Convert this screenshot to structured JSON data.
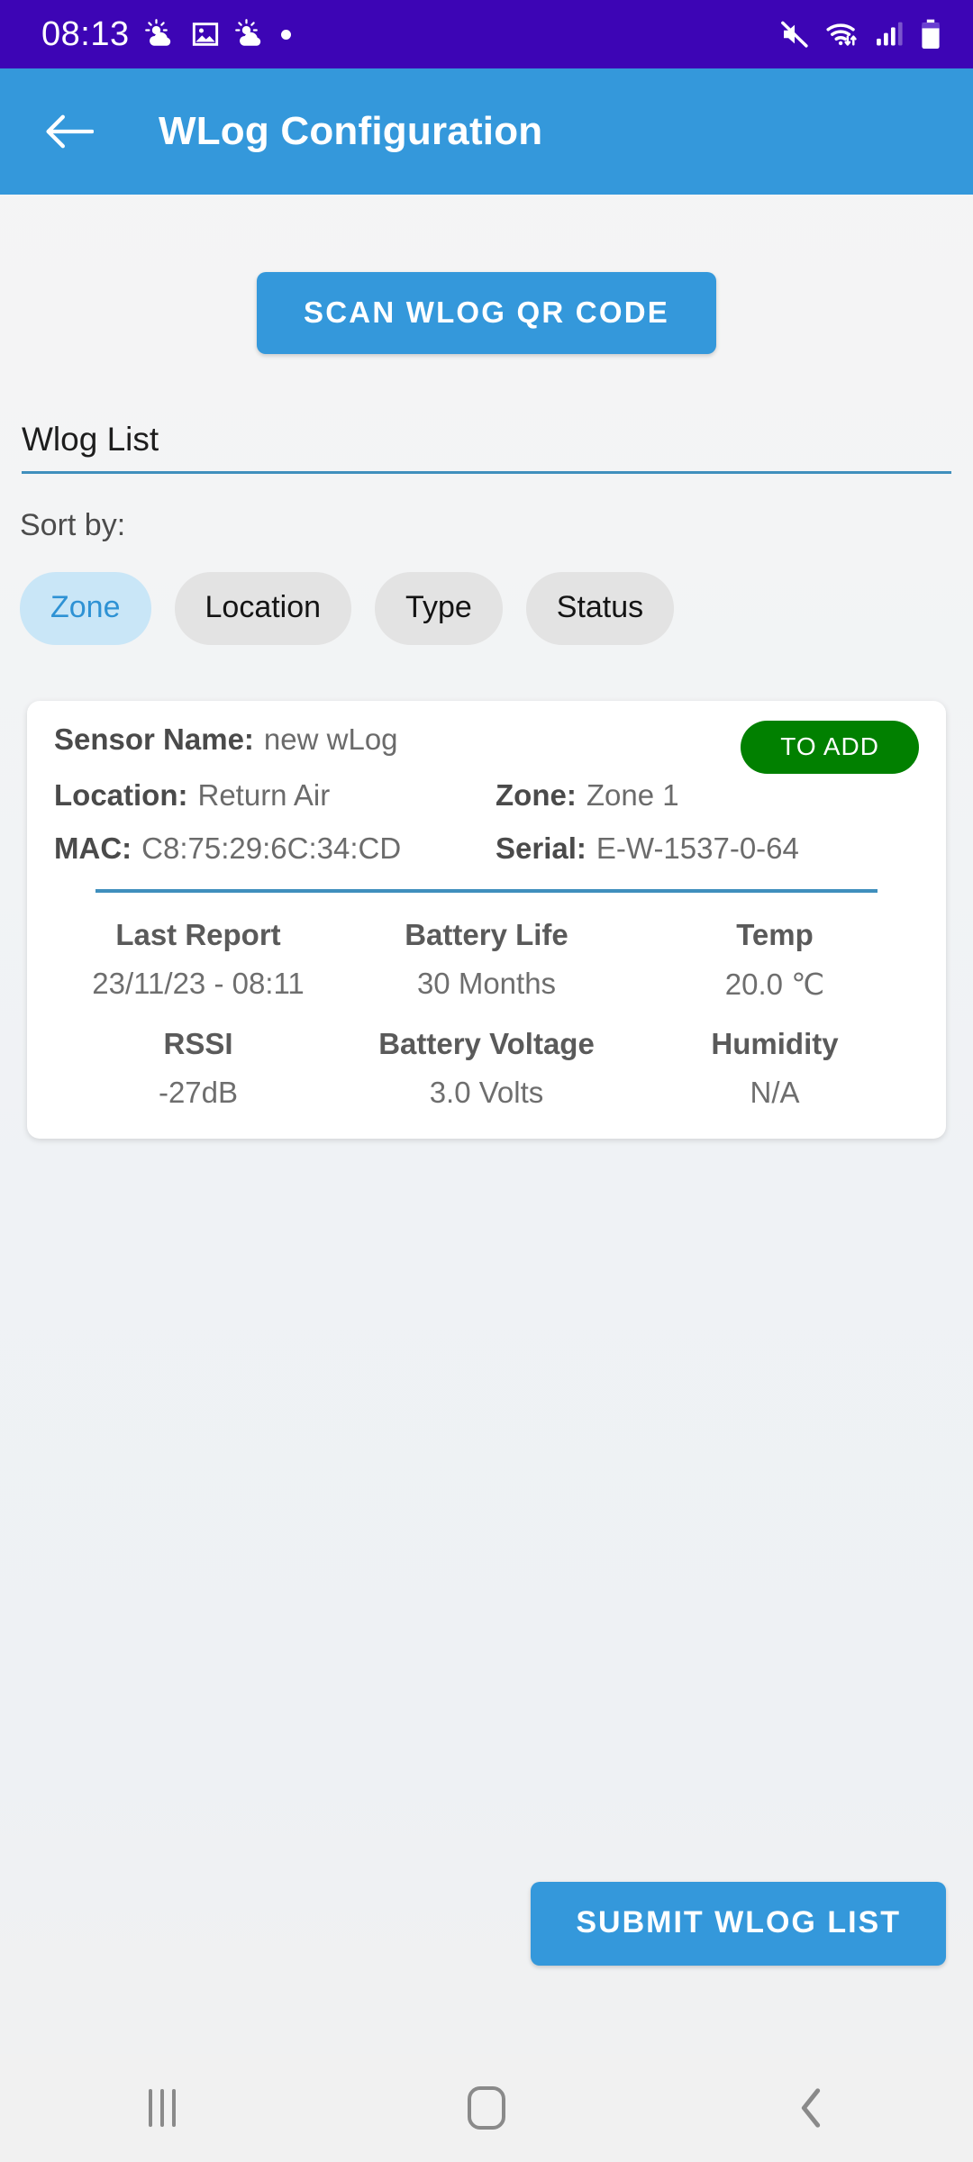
{
  "status_bar": {
    "time": "08:13",
    "left_icons": [
      "weather-icon",
      "gallery-icon",
      "weather-icon",
      "dot-indicator"
    ],
    "right_icons": [
      "mute-icon",
      "wifi-icon",
      "cellular-signal-icon",
      "battery-icon"
    ],
    "background_color": "#3d05b5"
  },
  "app_bar": {
    "title": "WLog Configuration",
    "back_icon": "arrow-left-icon",
    "background_color": "#3498db"
  },
  "scan": {
    "label": "SCAN WLOG QR CODE"
  },
  "list_section": {
    "header": "Wlog List",
    "rule_color": "#3f8fbd"
  },
  "sort": {
    "label": "Sort by:",
    "options": [
      {
        "label": "Zone",
        "selected": true
      },
      {
        "label": "Location",
        "selected": false
      },
      {
        "label": "Type",
        "selected": false
      },
      {
        "label": "Status",
        "selected": false
      }
    ],
    "selected_bg": "#c9e6f7",
    "selected_fg": "#2e92d4"
  },
  "card": {
    "status_badge": "TO ADD",
    "status_badge_color": "#018000",
    "fields": {
      "sensor_name_key": "Sensor Name:",
      "sensor_name_value": "new wLog",
      "location_key": "Location:",
      "location_value": "Return Air",
      "zone_key": "Zone:",
      "zone_value": "Zone 1",
      "mac_key": "MAC:",
      "mac_value": "C8:75:29:6C:34:CD",
      "serial_key": "Serial:",
      "serial_value": "E-W-1537-0-64"
    },
    "metrics": [
      {
        "label": "Last Report",
        "value": "23/11/23 - 08:11"
      },
      {
        "label": "Battery Life",
        "value": "30 Months"
      },
      {
        "label": "Temp",
        "value": "20.0 ℃"
      },
      {
        "label": "RSSI",
        "value": "-27dB"
      },
      {
        "label": "Battery Voltage",
        "value": "3.0 Volts"
      },
      {
        "label": "Humidity",
        "value": "N/A"
      }
    ]
  },
  "submit": {
    "label": "SUBMIT WLOG LIST"
  },
  "nav_bar": {
    "recents_icon": "recents-icon",
    "home_icon": "home-icon",
    "back_icon": "back-chevron-icon"
  }
}
